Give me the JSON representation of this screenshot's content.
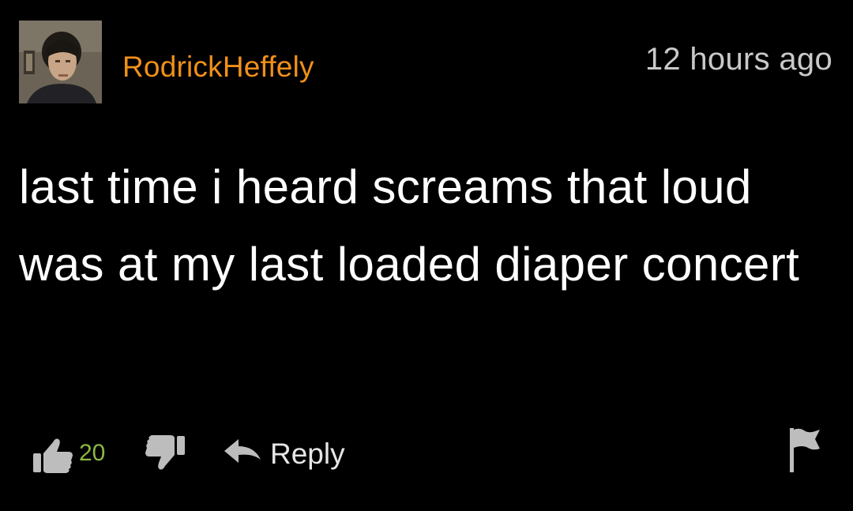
{
  "comment": {
    "author": "RodrickHeffely",
    "time_ago": "12 hours ago",
    "text": "last time i heard screams that loud was at my last loaded diaper concert",
    "likes": "20",
    "reply_label": "Reply"
  },
  "colors": {
    "background": "#000000",
    "username": "#f0901a",
    "timestamp": "#c9c9c9",
    "like_count": "#8cb843",
    "icon": "#bdbdbd"
  },
  "icons": {
    "like": "thumbs-up-icon",
    "dislike": "thumbs-down-icon",
    "reply": "reply-arrow-icon",
    "flag": "flag-icon"
  }
}
